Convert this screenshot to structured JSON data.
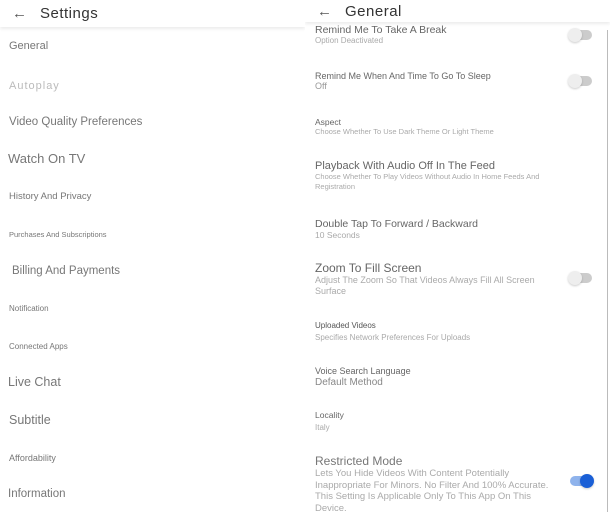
{
  "left": {
    "title": "Settings",
    "items": [
      "General",
      "Autoplay",
      "Video Quality Preferences",
      "Watch On TV",
      "History And Privacy",
      "Purchases And Subscriptions",
      "Billing And Payments",
      "Notification",
      "Connected Apps",
      "Live Chat",
      "Subtitle",
      "Affordability",
      "Information"
    ]
  },
  "right": {
    "title": "General",
    "items": [
      {
        "title": "Remind Me To Take A Break",
        "sub": "Option Deactivated",
        "toggle": false
      },
      {
        "title": "Remind Me When And Time To Go To Sleep",
        "sub": "Off",
        "toggle": false
      },
      {
        "title": "Aspect",
        "sub": "Choose Whether To Use Dark Theme Or Light Theme"
      },
      {
        "title": "Playback With Audio Off In The Feed",
        "sub": "Choose Whether To Play Videos Without Audio In Home Feeds And Registration"
      },
      {
        "title": "Double Tap To Forward / Backward",
        "sub": "10 Seconds"
      },
      {
        "title": "Zoom To Fill Screen",
        "sub": "Adjust The Zoom So That Videos Always Fill All Screen Surface",
        "toggle": false
      },
      {
        "title": "Uploaded Videos",
        "sub": "Specifies Network Preferences For Uploads"
      },
      {
        "title": "Voice Search Language",
        "sub": "Default Method"
      },
      {
        "title": "Locality",
        "sub": "Italy"
      },
      {
        "title": "Restricted Mode",
        "sub": "Lets You Hide Videos With Content Potentially Inappropriate For Minors. No Filter And 100% Accurate. This Setting Is Applicable Only To This App On This Device.",
        "toggle": true
      }
    ]
  },
  "colors": {
    "accent": "#1a5fd6"
  },
  "icons": {
    "back": "arrow-left-icon"
  }
}
